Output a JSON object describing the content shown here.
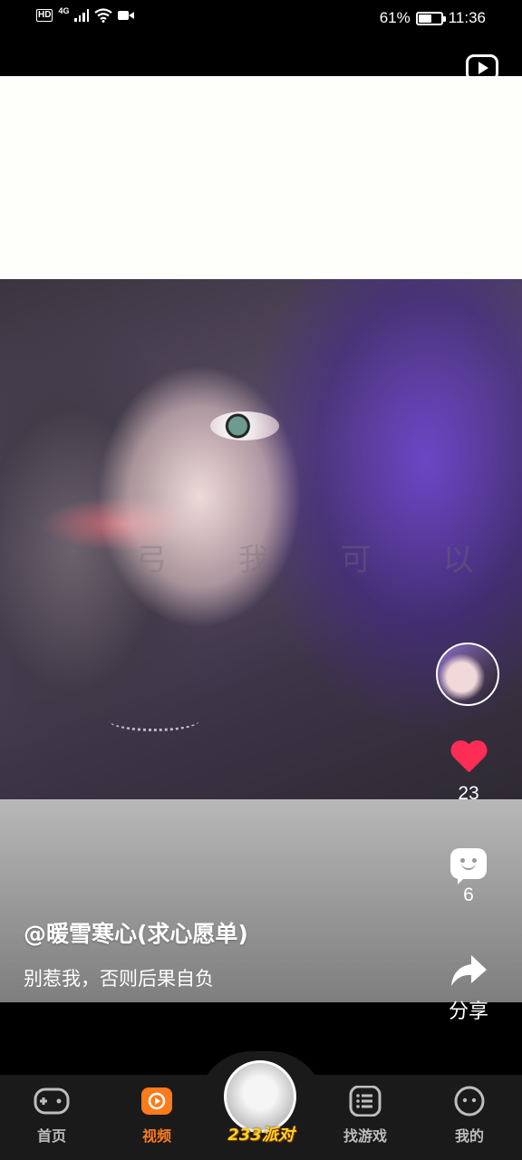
{
  "status_bar": {
    "hd": "HD",
    "network": "4G",
    "battery": "61%",
    "time": "11:36"
  },
  "video": {
    "watermark": "弓 我 可 以",
    "author": "@暖雪寒心(求心愿单)",
    "caption": "别惹我，否则后果自负"
  },
  "actions": {
    "likes": "23",
    "comments": "6",
    "share_label": "分享"
  },
  "bottom_nav": {
    "items": [
      {
        "label": "首页",
        "icon": "gamepad-icon"
      },
      {
        "label": "视频",
        "icon": "video-play-icon"
      },
      {
        "label": "233派对",
        "icon": "center-avatar"
      },
      {
        "label": "找游戏",
        "icon": "list-icon"
      },
      {
        "label": "我的",
        "icon": "smile-icon"
      }
    ],
    "active": "视频"
  },
  "colors": {
    "accent": "#ff7a1a",
    "like": "#ff2d55",
    "center_label": "#ffd21f"
  }
}
